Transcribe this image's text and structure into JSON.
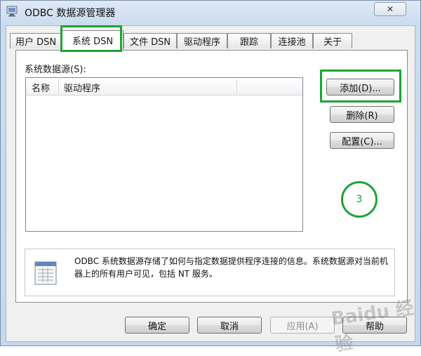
{
  "window": {
    "title": "ODBC 数据源管理器",
    "close_label": "✕"
  },
  "tabs": [
    {
      "label": "用户 DSN"
    },
    {
      "label": "系统 DSN"
    },
    {
      "label": "文件 DSN"
    },
    {
      "label": "驱动程序"
    },
    {
      "label": "跟踪"
    },
    {
      "label": "连接池"
    },
    {
      "label": "关于"
    }
  ],
  "active_tab": "系统 DSN",
  "system_dsn": {
    "list_label": "系统数据源(S):",
    "columns": [
      "名称",
      "驱动程序"
    ],
    "rows": []
  },
  "buttons": {
    "add": "添加(D)...",
    "remove": "删除(R)",
    "configure": "配置(C)..."
  },
  "annotation": {
    "step_number": "3",
    "highlight_color": "#1ea337"
  },
  "info": {
    "text": "ODBC 系统数据源存储了如何与指定数据提供程序连接的信息。系统数据源对当前机器上的所有用户可见，包括 NT 服务。"
  },
  "footer": {
    "ok": "确定",
    "cancel": "取消",
    "apply": "应用(A)",
    "help": "帮助"
  },
  "watermark": "Baidu 经验"
}
